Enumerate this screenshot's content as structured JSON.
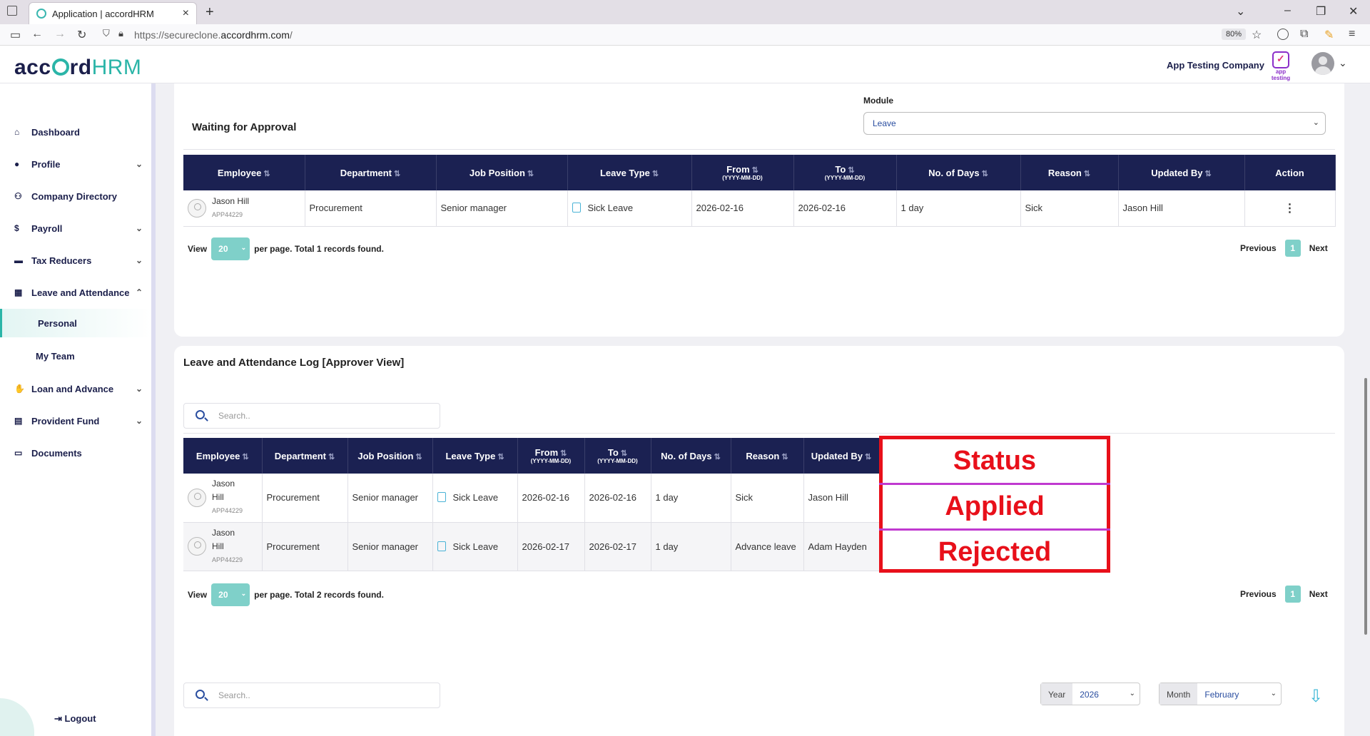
{
  "browser": {
    "tab_title": "Application | accordHRM",
    "url_prefix": "https://secureclone.",
    "url_domain": "accordhrm.com",
    "url_suffix": "/",
    "zoom": "80%"
  },
  "header": {
    "logo_main": "acc",
    "logo_rest": "rd",
    "logo_hrm": "HRM",
    "company": "App Testing Company",
    "company_logo_text": "app testing"
  },
  "sidebar": {
    "items": [
      {
        "label": "Dashboard",
        "icon": "home-icon"
      },
      {
        "label": "Profile",
        "icon": "user-icon"
      },
      {
        "label": "Company Directory",
        "icon": "people-icon"
      },
      {
        "label": "Payroll",
        "icon": "dollar-icon"
      },
      {
        "label": "Tax Reducers",
        "icon": "card-icon"
      },
      {
        "label": "Leave and Attendance",
        "icon": "calendar-icon"
      },
      {
        "label": "Loan and Advance",
        "icon": "hand-coin-icon"
      },
      {
        "label": "Provident Fund",
        "icon": "document-icon"
      },
      {
        "label": "Documents",
        "icon": "folder-icon"
      }
    ],
    "sub_items": [
      "Personal",
      "My Team"
    ],
    "logout": "Logout"
  },
  "approval": {
    "title": "Waiting for Approval",
    "module_label": "Module",
    "module_value": "Leave",
    "headers": [
      "Employee",
      "Department",
      "Job Position",
      "Leave Type",
      "From",
      "To",
      "No. of Days",
      "Reason",
      "Updated By",
      "Action"
    ],
    "date_format": "(YYYY-MM-DD)",
    "rows": [
      {
        "name": "Jason Hill",
        "id": "APP44229",
        "department": "Procurement",
        "position": "Senior manager",
        "leave_type": "Sick Leave",
        "from": "2026-02-16",
        "to": "2026-02-16",
        "days": "1 day",
        "reason": "Sick",
        "updated_by": "Jason Hill"
      }
    ],
    "view_label": "View",
    "per_page": "20",
    "total_text": "per page. Total 1 records found.",
    "prev": "Previous",
    "page": "1",
    "next": "Next"
  },
  "log": {
    "title": "Leave and Attendance Log [Approver View]",
    "search_placeholder": "Search..",
    "headers": [
      "Employee",
      "Department",
      "Job Position",
      "Leave Type",
      "From",
      "To",
      "No. of Days",
      "Reason",
      "Updated By"
    ],
    "date_format": "(YYYY-MM-DD)",
    "rows": [
      {
        "first": "Jason",
        "last": "Hill",
        "id": "APP44229",
        "department": "Procurement",
        "position": "Senior manager",
        "leave_type": "Sick Leave",
        "from": "2026-02-16",
        "to": "2026-02-16",
        "days": "1 day",
        "reason": "Sick",
        "updated_by": "Jason Hill"
      },
      {
        "first": "Jason",
        "last": "Hill",
        "id": "APP44229",
        "department": "Procurement",
        "position": "Senior manager",
        "leave_type": "Sick Leave",
        "from": "2026-02-17",
        "to": "2026-02-17",
        "days": "1 day",
        "reason": "Advance leave",
        "updated_by": "Adam Hayden"
      }
    ],
    "view_label": "View",
    "per_page": "20",
    "total_text": "per page. Total 2 records found.",
    "prev": "Previous",
    "page": "1",
    "next": "Next"
  },
  "annotation": {
    "header": "Status",
    "values": [
      "Applied",
      "Rejected"
    ],
    "color": "#e8101a"
  },
  "attendance": {
    "search_placeholder": "Search..",
    "year_label": "Year",
    "year_value": "2026",
    "month_label": "Month",
    "month_value": "February"
  },
  "colors": {
    "primary": "#1b2152",
    "accent": "#2bb5a8",
    "pager": "#7fd0c9"
  }
}
